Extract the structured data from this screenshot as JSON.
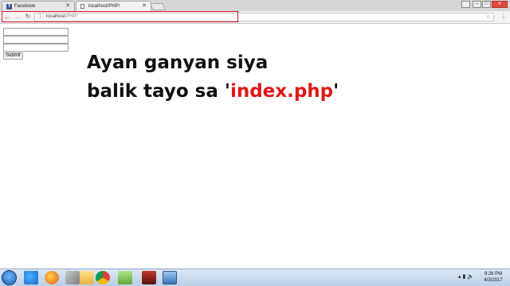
{
  "browser": {
    "tabs": [
      {
        "favicon": "facebook-icon",
        "label": "Facebook"
      },
      {
        "favicon": "document-icon",
        "label": "localhost/PHP/"
      }
    ],
    "address": {
      "host": "localhost",
      "path": "/PHP/"
    },
    "highlight_color": "#d21c1c"
  },
  "form": {
    "input1_value": "",
    "input2_value": "",
    "input3_value": "",
    "submit_label": "Submit"
  },
  "message": {
    "line1": "Ayan ganyan siya",
    "line2_prefix": "balik tayo sa '",
    "line2_highlight": "index.php",
    "line2_suffix": "'",
    "highlight_color": "#e01717"
  },
  "taskbar": {
    "icons": [
      "windows-start-icon",
      "internet-explorer-icon",
      "firefox-icon",
      "tools-icon",
      "folder-icon",
      "chrome-icon",
      "notepad-plus-plus-icon",
      "game-icon",
      "remote-desktop-icon"
    ],
    "clock": {
      "time": "9:26 PM",
      "date": "4/3/2017"
    }
  }
}
